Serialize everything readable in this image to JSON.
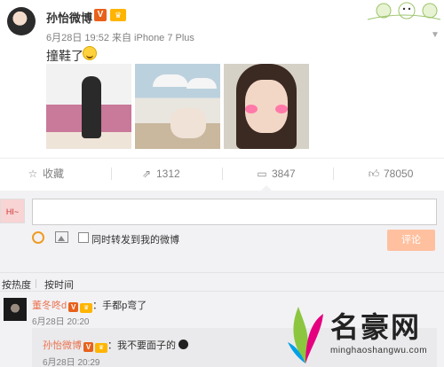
{
  "post": {
    "username": "孙怡微博",
    "badge_v": "V",
    "badge_crown": "♛",
    "meta": "6月28日 19:52 来自 iPhone 7 Plus",
    "text": "撞鞋了",
    "photos": [
      "photo-1",
      "photo-2",
      "photo-3"
    ]
  },
  "actions": {
    "favorite": "收藏",
    "repost": "1312",
    "comment": "3847",
    "like": "78050"
  },
  "composer": {
    "avatar_text": "HI~",
    "repost_label": "同时转发到我的微博",
    "submit_label": "评论"
  },
  "sort": {
    "by_hot": "按热度",
    "by_time": "按时间"
  },
  "comment": {
    "user": "董冬咚d",
    "text": "：手都p弯了",
    "time": "6月28日 20:20"
  },
  "reply": {
    "user": "孙怡微博",
    "text": "：我不要面子的",
    "time": "6月28日 20:29"
  },
  "watermark": {
    "title": "名豪网",
    "url": "minghaoshangwu.com"
  },
  "colors": {
    "accent": "#eb7350",
    "submit": "#ffc09f",
    "panel": "#f2f2f5"
  }
}
